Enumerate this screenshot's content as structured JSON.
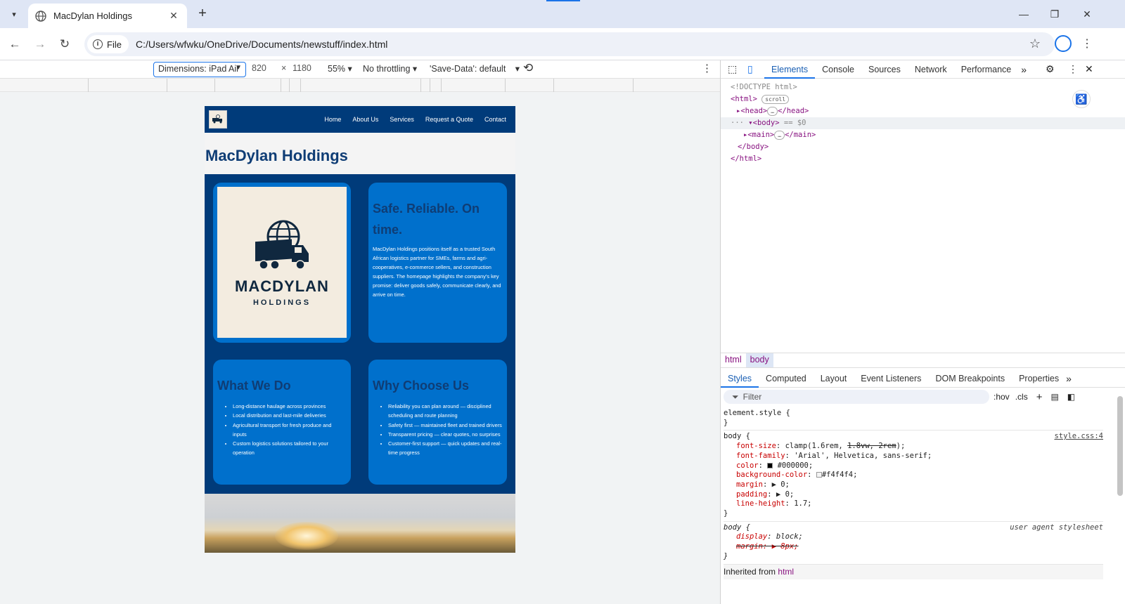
{
  "browser": {
    "tab_title": "MacDylan Holdings",
    "file_label": "File",
    "url": "C:/Users/wfwku/OneDrive/Documents/newstuff/index.html"
  },
  "device_toolbar": {
    "dimensions": "Dimensions: iPad Air",
    "width": "820",
    "times": "×",
    "height": "1180",
    "zoom": "55%",
    "throttling": "No throttling",
    "save_data": "'Save-Data': default"
  },
  "site": {
    "nav": [
      "Home",
      "About Us",
      "Services",
      "Request a Quote",
      "Contact"
    ],
    "title": "MacDylan Holdings",
    "logo_big": "MACDYLAN",
    "logo_small": "HOLDINGS",
    "hero_heading": "Safe. Reliable. On time.",
    "hero_text": "MacDylan Holdings positions itself as a trusted South African logistics partner for SMEs, farms and agri-cooperatives, e-commerce sellers, and construction suppliers. The homepage highlights the company's key promise: deliver goods safely, communicate clearly, and arrive on time.",
    "what_heading": "What We Do",
    "what_items": [
      "Long-distance haulage across provinces",
      "Local distribution and last-mile deliveries",
      "Agricultural transport for fresh produce and inputs",
      "Custom logistics solutions tailored to your operation"
    ],
    "why_heading": "Why Choose Us",
    "why_items": [
      "Reliability you can plan around — disciplined scheduling and route planning",
      "Safety first — maintained fleet and trained drivers",
      "Transparent pricing — clear quotes, no surprises",
      "Customer-first support — quick updates and real-time progress"
    ]
  },
  "devtools": {
    "tabs": [
      "Elements",
      "Console",
      "Sources",
      "Network",
      "Performance"
    ],
    "dom": {
      "doctype": "<!DOCTYPE html>",
      "html_open": "<html>",
      "scroll_pill": "scroll",
      "head": "<head>",
      "head_close": "</head>",
      "body": "<body>",
      "body_marker": "== $0",
      "main": "<main>",
      "main_close": "</main>",
      "body_close": "</body>",
      "html_close": "</html>"
    },
    "crumbs": [
      "html",
      "body"
    ],
    "style_tabs": [
      "Styles",
      "Computed",
      "Layout",
      "Event Listeners",
      "DOM Breakpoints",
      "Properties"
    ],
    "filter_placeholder": "Filter",
    "hov": ":hov",
    "cls": ".cls",
    "css": {
      "element_style": "element.style {",
      "close": "}",
      "body_sel": "body {",
      "source": "style.css:4",
      "font_size_prop": "font-size",
      "font_size_val": "clamp(1.6rem,",
      "font_size_strike": "1.8vw, 2rem",
      "font_size_end": ");",
      "font_family_prop": "font-family",
      "font_family_val": "'Arial', Helvetica, sans-serif;",
      "color_prop": "color",
      "color_val": "#000000;",
      "bg_prop": "background-color",
      "bg_val": "#f4f4f4;",
      "margin_prop": "margin",
      "margin_val": "0;",
      "padding_prop": "padding",
      "padding_val": "0;",
      "lh_prop": "line-height",
      "lh_val": "1.7;",
      "ua_label": "user agent stylesheet",
      "display_prop": "display",
      "display_val": "block;",
      "ua_margin": "margin: ▶ 8px;",
      "inherited": "Inherited from",
      "inherited_tag": "html"
    }
  },
  "colors": {
    "nav_bg": "#003b7a",
    "card_bg": "#0070cc",
    "title": "#0f3d75",
    "page_bg": "#f4f4f4"
  }
}
